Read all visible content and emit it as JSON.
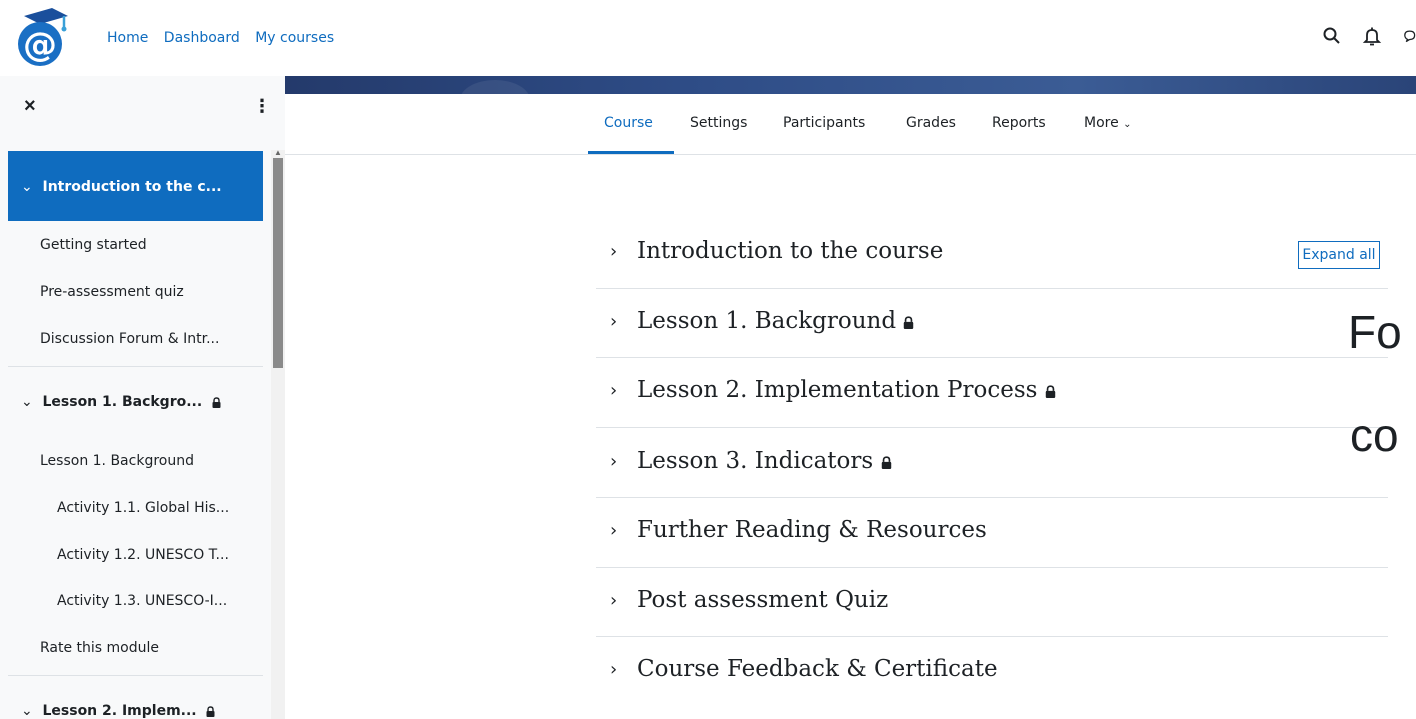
{
  "navbar": {
    "links": [
      "Home",
      "Dashboard",
      "My courses"
    ]
  },
  "secondary_nav": {
    "tabs": [
      "Course",
      "Settings",
      "Participants",
      "Grades",
      "Reports",
      "More"
    ],
    "active": "Course"
  },
  "drawer": {
    "close_label": "×",
    "menu_label": "⋮",
    "sections": [
      {
        "title": "Introduction to the c...",
        "active": true,
        "locked": false,
        "items": [
          "Getting started",
          "Pre-assessment quiz",
          "Discussion Forum & Intr..."
        ]
      },
      {
        "title": "Lesson 1. Backgro...",
        "active": false,
        "locked": true,
        "items": [
          "Lesson 1. Background",
          "Activity 1.1. Global His...",
          "Activity 1.2. UNESCO T...",
          "Activity 1.3. UNESCO-I...",
          "Rate this module"
        ]
      },
      {
        "title": "Lesson 2. Implem...",
        "active": false,
        "locked": true,
        "items": []
      }
    ]
  },
  "main": {
    "expand_all": "Expand all",
    "sections": [
      {
        "title": "Introduction to the course",
        "locked": false
      },
      {
        "title": "Lesson 1. Background",
        "locked": true
      },
      {
        "title": "Lesson 2. Implementation Process",
        "locked": true
      },
      {
        "title": "Lesson 3. Indicators",
        "locked": true
      },
      {
        "title": "Further Reading & Resources",
        "locked": false
      },
      {
        "title": "Post assessment Quiz",
        "locked": false
      },
      {
        "title": "Course Feedback & Certificate",
        "locked": false
      }
    ],
    "overlay_text": [
      "Fo",
      "co"
    ]
  },
  "colors": {
    "accent": "#0f6cbf",
    "banner": "#2e4c86",
    "text": "#1d2125"
  }
}
